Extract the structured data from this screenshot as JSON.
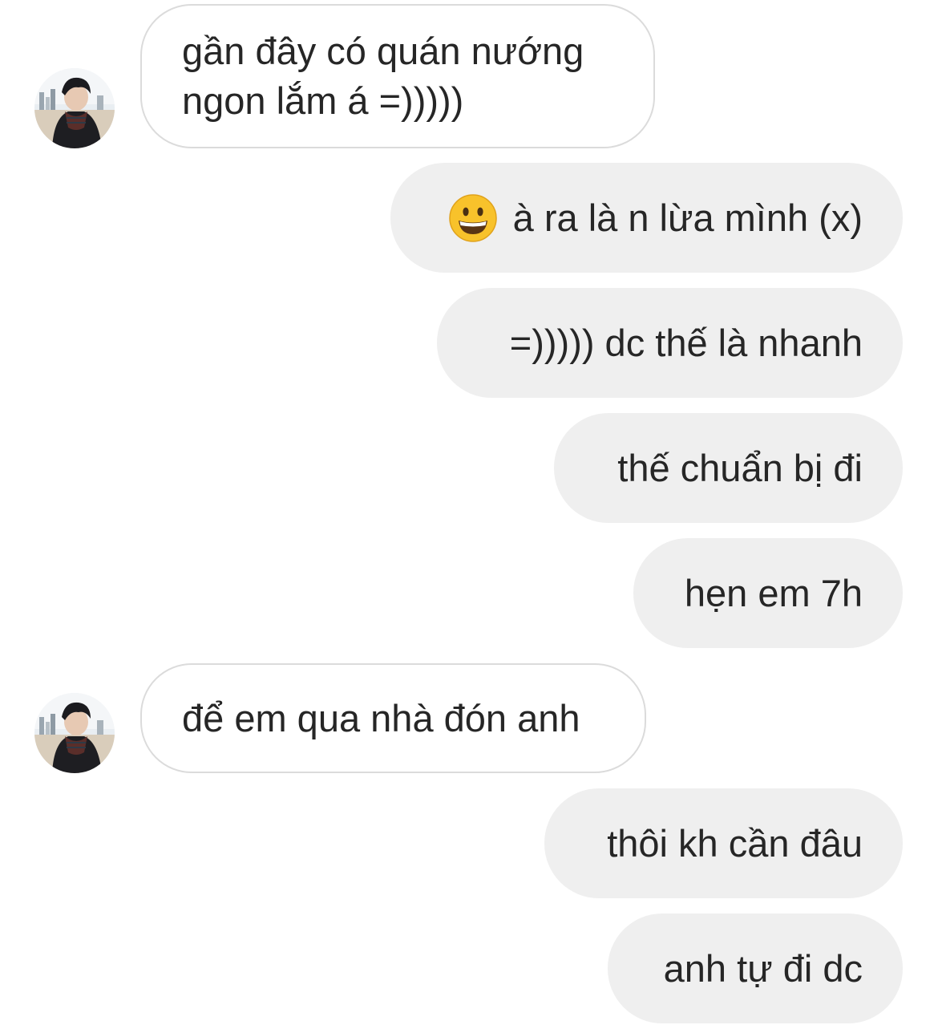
{
  "conversation": {
    "messages": [
      {
        "side": "incoming",
        "text_line1": "gần đây có quán nướng",
        "text_line2": "ngon lắm á =)))))"
      },
      {
        "side": "outgoing",
        "emoji": "grinning-face-emoji",
        "text": "à ra là n lừa mình (x)"
      },
      {
        "side": "outgoing",
        "text": "=))))) dc thế là nhanh"
      },
      {
        "side": "outgoing",
        "text": "thế chuẩn bị đi"
      },
      {
        "side": "outgoing",
        "text": "hẹn em 7h"
      },
      {
        "side": "incoming",
        "text": "để em qua nhà đón anh"
      },
      {
        "side": "outgoing",
        "text": "thôi kh cần đâu"
      },
      {
        "side": "outgoing",
        "text": "anh tự đi dc"
      }
    ]
  },
  "colors": {
    "background": "#ffffff",
    "outgoing_bubble": "#efefef",
    "incoming_border": "#dbdbdb",
    "text": "#262626",
    "emoji_yellow": "#f8c22b"
  }
}
